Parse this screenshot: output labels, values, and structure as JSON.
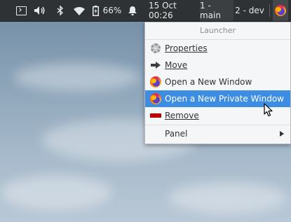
{
  "panel": {
    "battery_percent": "66%",
    "clock": "15 Oct 00:26",
    "workspaces": [
      "1 - main",
      "2 - dev"
    ],
    "icons": [
      "terminal-icon",
      "volume-icon",
      "bluetooth-icon",
      "wifi-icon",
      "battery-icon",
      "bell-icon",
      "firefox-icon"
    ]
  },
  "menu": {
    "title": "Launcher",
    "items": [
      {
        "label": "Properties",
        "icon": "gear-icon"
      },
      {
        "label": "Move",
        "icon": "arrow-right-icon"
      },
      {
        "label": "Open a New Window",
        "icon": "firefox-icon"
      },
      {
        "label": "Open a New Private Window",
        "icon": "firefox-icon",
        "highlighted": true
      },
      {
        "label": "Remove",
        "icon": "remove-icon"
      },
      {
        "label": "Panel",
        "icon": "",
        "has_submenu": true
      }
    ]
  },
  "colors": {
    "panel_bg": "#2f3234",
    "menu_bg": "#f5f6f7",
    "highlight": "#3d8ee3"
  }
}
